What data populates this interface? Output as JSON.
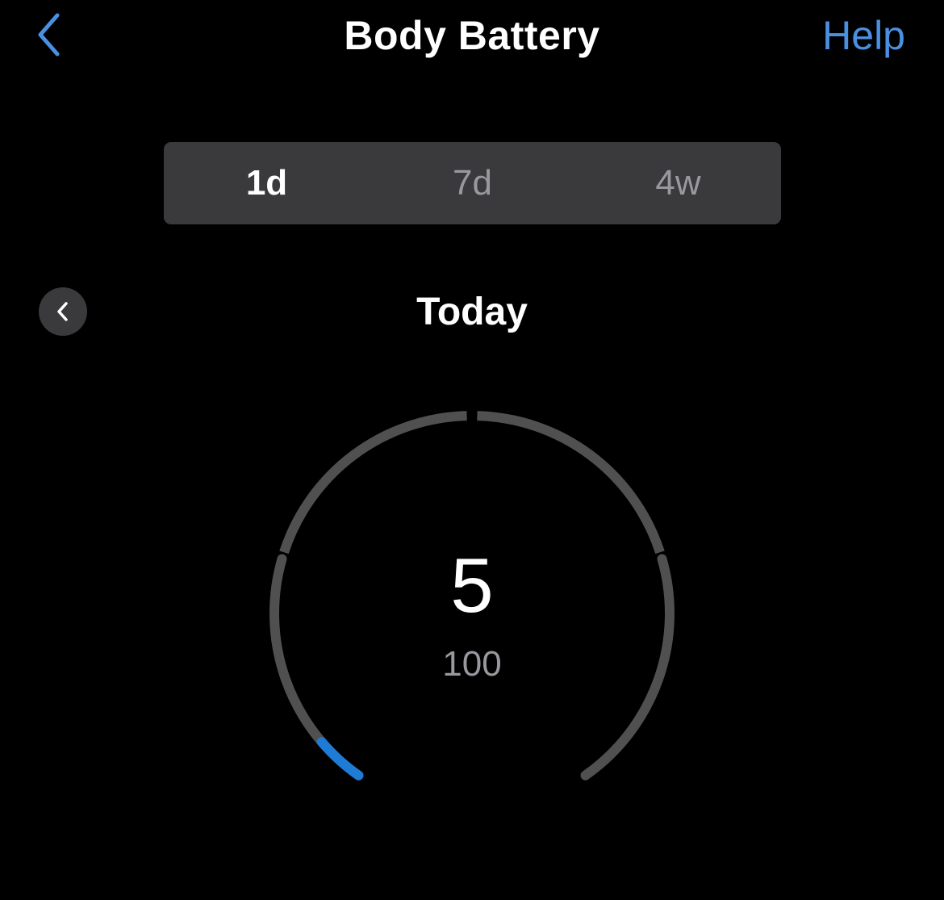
{
  "header": {
    "title": "Body Battery",
    "help_label": "Help",
    "back_icon": "chevron-left-icon"
  },
  "range_tabs": [
    {
      "label": "1d",
      "selected": true
    },
    {
      "label": "7d",
      "selected": false
    },
    {
      "label": "4w",
      "selected": false
    }
  ],
  "period": {
    "label": "Today",
    "prev_icon": "chevron-left-icon"
  },
  "gauge": {
    "value": "5",
    "max": "100",
    "level_fraction": 0.05
  },
  "colors": {
    "background": "#000000",
    "accent": "#4a90e2",
    "gauge_fill": "#1e7bd6",
    "gauge_track": "#505050",
    "segment_bg": "#3a3a3c",
    "secondary_text": "#98989e"
  }
}
